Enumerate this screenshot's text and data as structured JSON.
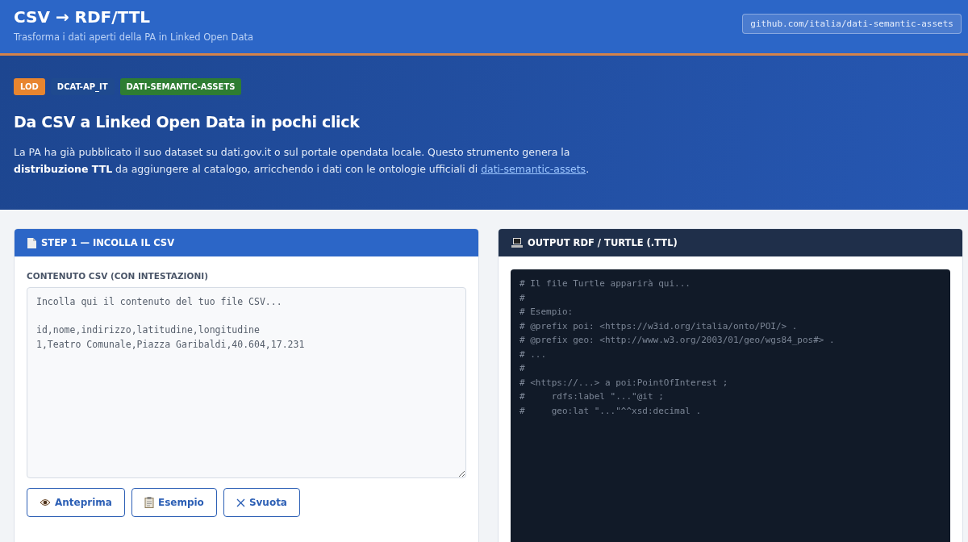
{
  "header": {
    "title": "CSV → RDF/TTL",
    "subtitle": "Trasforma i dati aperti della PA in Linked Open Data",
    "repo_link": "github.com/italia/dati-semantic-assets"
  },
  "hero": {
    "badges": [
      {
        "label": "LOD",
        "color": "#e8852f"
      },
      {
        "label": "DCAT-AP_IT",
        "color": "#1f4a8f"
      },
      {
        "label": "DATI-SEMANTIC-ASSETS",
        "color": "#2e7d32"
      }
    ],
    "heading": "Da CSV a Linked Open Data in pochi click",
    "text": "La PA ha già pubblicato il suo dataset su dati.gov.it o sul portale opendata locale. Questo strumento genera la **distribuzione TTL** da aggiungere al catalogo, arricchendo i dati con le ontologie ufficiali di ",
    "link": "dati-semantic-assets",
    "text_end": "."
  },
  "input_panel": {
    "title": "STEP 1 — INCOLLA IL CSV",
    "field_label": "CONTENUTO CSV (CON INTESTAZIONI)",
    "placeholder": "Incolla qui il contenuto del tuo file CSV...\n\nid,nome,indirizzo,latitudine,longitudine\n1,Teatro Comunale,Piazza Garibaldi,40.604,17.231",
    "buttons": [
      {
        "label": "Anteprima",
        "kind": "eye"
      },
      {
        "label": "Esempio",
        "kind": "clipboard"
      },
      {
        "label": "Svuota",
        "kind": "clear"
      }
    ]
  },
  "output_panel": {
    "title": "OUTPUT RDF / TURTLE (.TTL)",
    "lines": [
      "# Il file Turtle apparirà qui...",
      "#",
      "# Esempio:",
      "# @prefix poi: <https://w3id.org/italia/onto/POI/> .",
      "# @prefix geo: <http://www.w3.org/2003/01/geo/wgs84_pos#> .",
      "# ...",
      "#",
      "# <https://...> a poi:PointOfInterest ;",
      "#     rdfs:label \"...\"@it ;",
      "#     geo:lat \"...\"^^xsd:decimal ."
    ]
  }
}
